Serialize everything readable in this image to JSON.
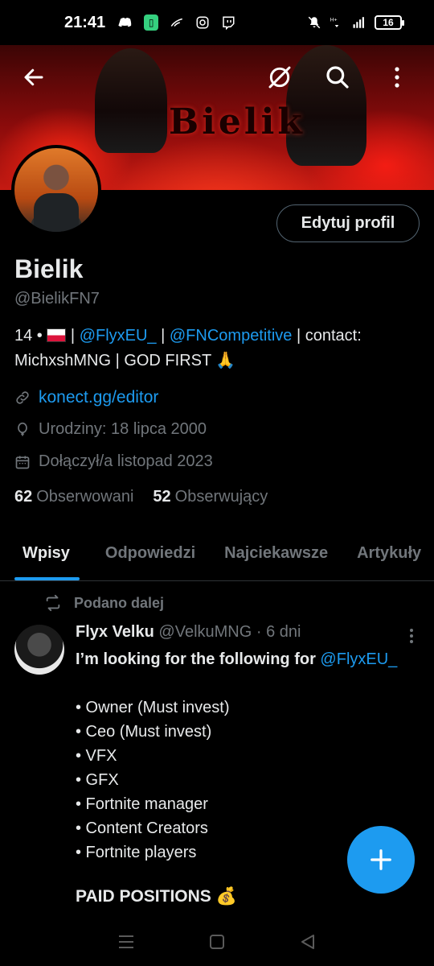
{
  "status_bar": {
    "time": "21:41",
    "battery": "16",
    "left_icons": [
      "discord-icon",
      "chat-app-icon",
      "app-icon",
      "instagram-icon",
      "twitch-icon"
    ],
    "right_icons": [
      "mute-icon",
      "wifi-icon",
      "signal-icon",
      "battery-icon"
    ]
  },
  "header": {
    "back_icon": "arrow-left-icon",
    "icons": [
      "grok-icon",
      "search-icon",
      "more-vertical-icon"
    ],
    "banner_text": "Bielik"
  },
  "profile": {
    "edit_button": "Edytuj profil",
    "name": "Bielik",
    "handle": "@BielikFN7",
    "bio": {
      "age": "14 •",
      "sep1": " | ",
      "mention1": "@FlyxEU_",
      "sep2": " | ",
      "mention2": "@FNCompetitive",
      "rest": " | contact: MichxshMNG | GOD FIRST 🙏"
    },
    "website": "konect.gg/editor",
    "birthday": "Urodziny: 18 lipca 2000",
    "joined": "Dołączył/a listopad 2023",
    "following_count": "62",
    "following_label": "Obserwowani",
    "followers_count": "52",
    "followers_label": "Obserwujący"
  },
  "tabs": [
    "Wpisy",
    "Odpowiedzi",
    "Najciekawsze",
    "Artykuły"
  ],
  "post": {
    "repost_label": "Podano dalej",
    "author_name": "Flyx Velku",
    "author_handle": "@VelkuMNG",
    "time": "· 6 dni",
    "lead": "I’m looking for the following for ",
    "lead_mention": "@FlyxEU_",
    "items": [
      "• Owner (Must invest)",
      "• Ceo (Must invest)",
      "• VFX",
      "• GFX",
      "• Fortnite manager",
      "• Content Creators",
      "• Fortnite players"
    ],
    "paid": "PAID POSITIONS 💰"
  },
  "colors": {
    "accent": "#1d9bf0",
    "text": "#e7e9ea",
    "muted": "#71767b",
    "background": "#000000"
  }
}
